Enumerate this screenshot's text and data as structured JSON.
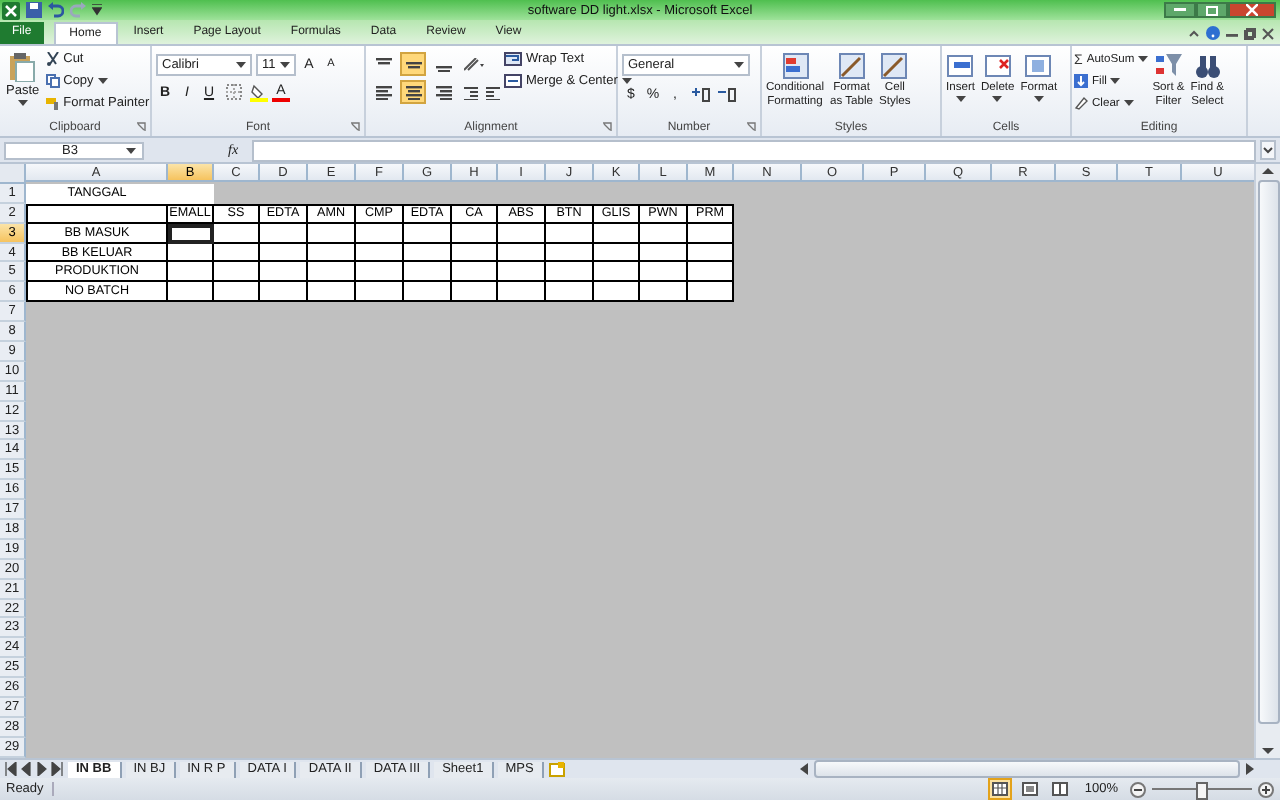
{
  "window": {
    "title": "software DD light.xlsx - Microsoft Excel"
  },
  "ribbon_tabs": [
    {
      "label": "File",
      "kind": "file",
      "selected": false
    },
    {
      "label": "Home",
      "kind": "tab",
      "selected": true
    },
    {
      "label": "Insert",
      "kind": "tab",
      "selected": false
    },
    {
      "label": "Page Layout",
      "kind": "tab",
      "selected": false
    },
    {
      "label": "Formulas",
      "kind": "tab",
      "selected": false
    },
    {
      "label": "Data",
      "kind": "tab",
      "selected": false
    },
    {
      "label": "Review",
      "kind": "tab",
      "selected": false
    },
    {
      "label": "View",
      "kind": "tab",
      "selected": false
    }
  ],
  "ribbon": [
    {
      "kind": "clipboard",
      "label": "Clipboard",
      "paste": "Paste",
      "items": [
        "Cut",
        "Copy",
        "Format Painter"
      ]
    },
    {
      "kind": "font",
      "label": "Font",
      "font": "Calibri",
      "size": "11",
      "size_buttons": [
        "A",
        "A"
      ],
      "buttons": [
        "B",
        "I",
        "U"
      ],
      "color_button": "A"
    },
    {
      "kind": "alignment",
      "label": "Alignment",
      "vertical": [
        {
          "selected": false
        },
        {
          "selected": true
        },
        {
          "selected": false
        }
      ],
      "horizontal": [
        {
          "selected": false
        },
        {
          "selected": true
        },
        {
          "selected": false
        }
      ],
      "wrap": "Wrap Text",
      "merge": "Merge & Center"
    },
    {
      "kind": "number",
      "label": "Number",
      "format": "General",
      "symbols": [
        "$",
        "%",
        ","
      ]
    },
    {
      "kind": "styles",
      "label": "Styles",
      "buttons": [
        "Conditional\nFormatting",
        "Format\nas Table",
        "Cell\nStyles"
      ]
    },
    {
      "kind": "cells",
      "label": "Cells",
      "buttons": [
        "Insert",
        "Delete",
        "Format"
      ]
    },
    {
      "kind": "editing",
      "label": "Editing",
      "sigma": "Σ",
      "items": [
        "AutoSum",
        "Fill",
        "Clear"
      ],
      "buttons": [
        "Sort &\nFilter",
        "Find &\nSelect"
      ]
    }
  ],
  "formula_bar": {
    "name_box": "B3",
    "fx": "fx"
  },
  "grid": {
    "columns": [
      {
        "letter": "A",
        "selected": false
      },
      {
        "letter": "B",
        "selected": true
      },
      {
        "letter": "C",
        "selected": false
      },
      {
        "letter": "D",
        "selected": false
      },
      {
        "letter": "E",
        "selected": false
      },
      {
        "letter": "F",
        "selected": false
      },
      {
        "letter": "G",
        "selected": false
      },
      {
        "letter": "H",
        "selected": false
      },
      {
        "letter": "I",
        "selected": false
      },
      {
        "letter": "J",
        "selected": false
      },
      {
        "letter": "K",
        "selected": false
      },
      {
        "letter": "L",
        "selected": false
      },
      {
        "letter": "M",
        "selected": false
      },
      {
        "letter": "N",
        "selected": false
      },
      {
        "letter": "O",
        "selected": false
      },
      {
        "letter": "P",
        "selected": false
      },
      {
        "letter": "Q",
        "selected": false
      },
      {
        "letter": "R",
        "selected": false
      },
      {
        "letter": "S",
        "selected": false
      },
      {
        "letter": "T",
        "selected": false
      },
      {
        "letter": "U",
        "selected": false
      }
    ],
    "rows": [
      {
        "number": "1",
        "selected": false,
        "cells": [
          {
            "text": "TANGGAL",
            "bordered": false
          },
          {
            "bordered": false
          }
        ]
      },
      {
        "number": "2",
        "selected": false,
        "cells": [
          {
            "bordered": true
          },
          {
            "text": "EMALL",
            "bordered": true
          },
          {
            "text": "SS",
            "bordered": true
          },
          {
            "text": "EDTA",
            "bordered": true
          },
          {
            "text": "AMN",
            "bordered": true
          },
          {
            "text": "CMP",
            "bordered": true
          },
          {
            "text": "EDTA",
            "bordered": true
          },
          {
            "text": "CA",
            "bordered": true
          },
          {
            "text": "ABS",
            "bordered": true
          },
          {
            "text": "BTN",
            "bordered": true
          },
          {
            "text": "GLIS",
            "bordered": true
          },
          {
            "text": "PWN",
            "bordered": true
          },
          {
            "text": "PRM",
            "bordered": true
          }
        ]
      },
      {
        "number": "3",
        "selected": true,
        "cells": [
          {
            "text": "BB MASUK",
            "bordered": true
          },
          {
            "bordered": true
          },
          {
            "bordered": true
          },
          {
            "bordered": true
          },
          {
            "bordered": true
          },
          {
            "bordered": true
          },
          {
            "bordered": true
          },
          {
            "bordered": true
          },
          {
            "bordered": true
          },
          {
            "bordered": true
          },
          {
            "bordered": true
          },
          {
            "bordered": true
          },
          {
            "bordered": true
          }
        ]
      },
      {
        "number": "4",
        "selected": false,
        "cells": [
          {
            "text": "BB KELUAR",
            "bordered": true
          },
          {
            "bordered": true
          },
          {
            "bordered": true
          },
          {
            "bordered": true
          },
          {
            "bordered": true
          },
          {
            "bordered": true
          },
          {
            "bordered": true
          },
          {
            "bordered": true
          },
          {
            "bordered": true
          },
          {
            "bordered": true
          },
          {
            "bordered": true
          },
          {
            "bordered": true
          },
          {
            "bordered": true
          }
        ]
      },
      {
        "number": "5",
        "selected": false,
        "cells": [
          {
            "text": "PRODUKTION",
            "bordered": true
          },
          {
            "bordered": true
          },
          {
            "bordered": true
          },
          {
            "bordered": true
          },
          {
            "bordered": true
          },
          {
            "bordered": true
          },
          {
            "bordered": true
          },
          {
            "bordered": true
          },
          {
            "bordered": true
          },
          {
            "bordered": true
          },
          {
            "bordered": true
          },
          {
            "bordered": true
          },
          {
            "bordered": true
          }
        ]
      },
      {
        "number": "6",
        "selected": false,
        "cells": [
          {
            "text": "NO BATCH",
            "bordered": true
          },
          {
            "bordered": true
          },
          {
            "bordered": true
          },
          {
            "bordered": true
          },
          {
            "bordered": true
          },
          {
            "bordered": true
          },
          {
            "bordered": true
          },
          {
            "bordered": true
          },
          {
            "bordered": true
          },
          {
            "bordered": true
          },
          {
            "bordered": true
          },
          {
            "bordered": true
          },
          {
            "bordered": true
          }
        ]
      },
      {
        "number": "7",
        "selected": false
      },
      {
        "number": "8",
        "selected": false
      },
      {
        "number": "9",
        "selected": false
      },
      {
        "number": "10",
        "selected": false
      },
      {
        "number": "11",
        "selected": false
      },
      {
        "number": "12",
        "selected": false
      },
      {
        "number": "13",
        "selected": false
      },
      {
        "number": "14",
        "selected": false
      },
      {
        "number": "15",
        "selected": false
      },
      {
        "number": "16",
        "selected": false
      },
      {
        "number": "17",
        "selected": false
      },
      {
        "number": "18",
        "selected": false
      },
      {
        "number": "19",
        "selected": false
      },
      {
        "number": "20",
        "selected": false
      },
      {
        "number": "21",
        "selected": false
      },
      {
        "number": "22",
        "selected": false
      },
      {
        "number": "23",
        "selected": false
      },
      {
        "number": "24",
        "selected": false
      },
      {
        "number": "25",
        "selected": false
      },
      {
        "number": "26",
        "selected": false
      },
      {
        "number": "27",
        "selected": false
      },
      {
        "number": "28",
        "selected": false
      },
      {
        "number": "29",
        "selected": false
      }
    ]
  },
  "sheet_tabs": [
    {
      "label": "IN BB",
      "selected": true
    },
    {
      "label": "IN BJ",
      "selected": false
    },
    {
      "label": "IN R P",
      "selected": false
    },
    {
      "label": "DATA I",
      "selected": false
    },
    {
      "label": "DATA II",
      "selected": false
    },
    {
      "label": "DATA III",
      "selected": false
    },
    {
      "label": "Sheet1",
      "selected": false
    },
    {
      "label": "MPS",
      "selected": false
    }
  ],
  "status_bar": {
    "status": "Ready",
    "zoom": {
      "reading": "100%",
      "level": 0.5
    }
  }
}
